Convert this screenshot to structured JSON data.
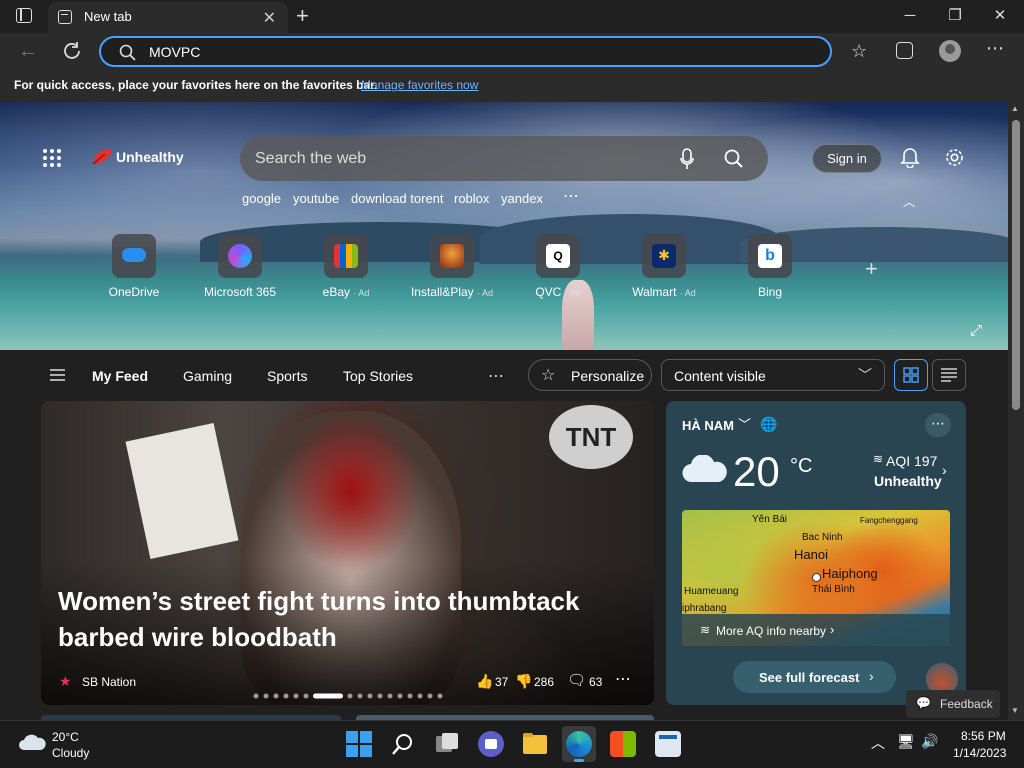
{
  "browser": {
    "tab_title": "New tab",
    "address_value": "MOVPC",
    "favbar_text": "For quick access, place your favorites here on the favorites bar.",
    "favbar_link": "Manage favorites now"
  },
  "hero": {
    "brand": "Unhealthy",
    "search_placeholder": "Search the web",
    "quick_links": [
      "google",
      "youtube",
      "download torent",
      "roblox",
      "yandex"
    ],
    "sign_in": "Sign in",
    "tiles": [
      {
        "label": "OneDrive",
        "ad": ""
      },
      {
        "label": "Microsoft 365",
        "ad": ""
      },
      {
        "label": "eBay",
        "ad": "· Ad"
      },
      {
        "label": "Install&Play",
        "ad": "· Ad"
      },
      {
        "label": "QVC",
        "ad": "· Ad"
      },
      {
        "label": "Walmart",
        "ad": "· Ad"
      },
      {
        "label": "Bing",
        "ad": ""
      }
    ]
  },
  "feed": {
    "nav": [
      "My Feed",
      "Gaming",
      "Sports",
      "Top Stories"
    ],
    "personalize": "Personalize",
    "content_visible": "Content visible",
    "headline": "Women’s street fight turns into thumbtack barbed wire bloodbath",
    "source": "SB Nation",
    "likes": "37",
    "dislikes": "286",
    "comments": "63"
  },
  "weather": {
    "location": "HÀ NAM",
    "temp": "20",
    "unit": "°C",
    "aqi": "AQI 197",
    "aqi_status": "Unhealthy",
    "map_labels": [
      "Yên Bái",
      "Bac Ninh",
      "Hanoi",
      "Haiphong",
      "Thái Bình",
      "Huameuang",
      "iphrabang",
      "Fangchenggang"
    ],
    "aq_link": "More AQ info nearby",
    "forecast": "See full forecast",
    "feedback": "Feedback"
  },
  "taskbar": {
    "weather_temp": "20°C",
    "weather_desc": "Cloudy",
    "time": "8:56 PM",
    "date": "1/14/2023"
  },
  "colors": {
    "accent": "#4aa2ff",
    "link": "#6cb4ff",
    "weather_card": "#2a4552"
  }
}
